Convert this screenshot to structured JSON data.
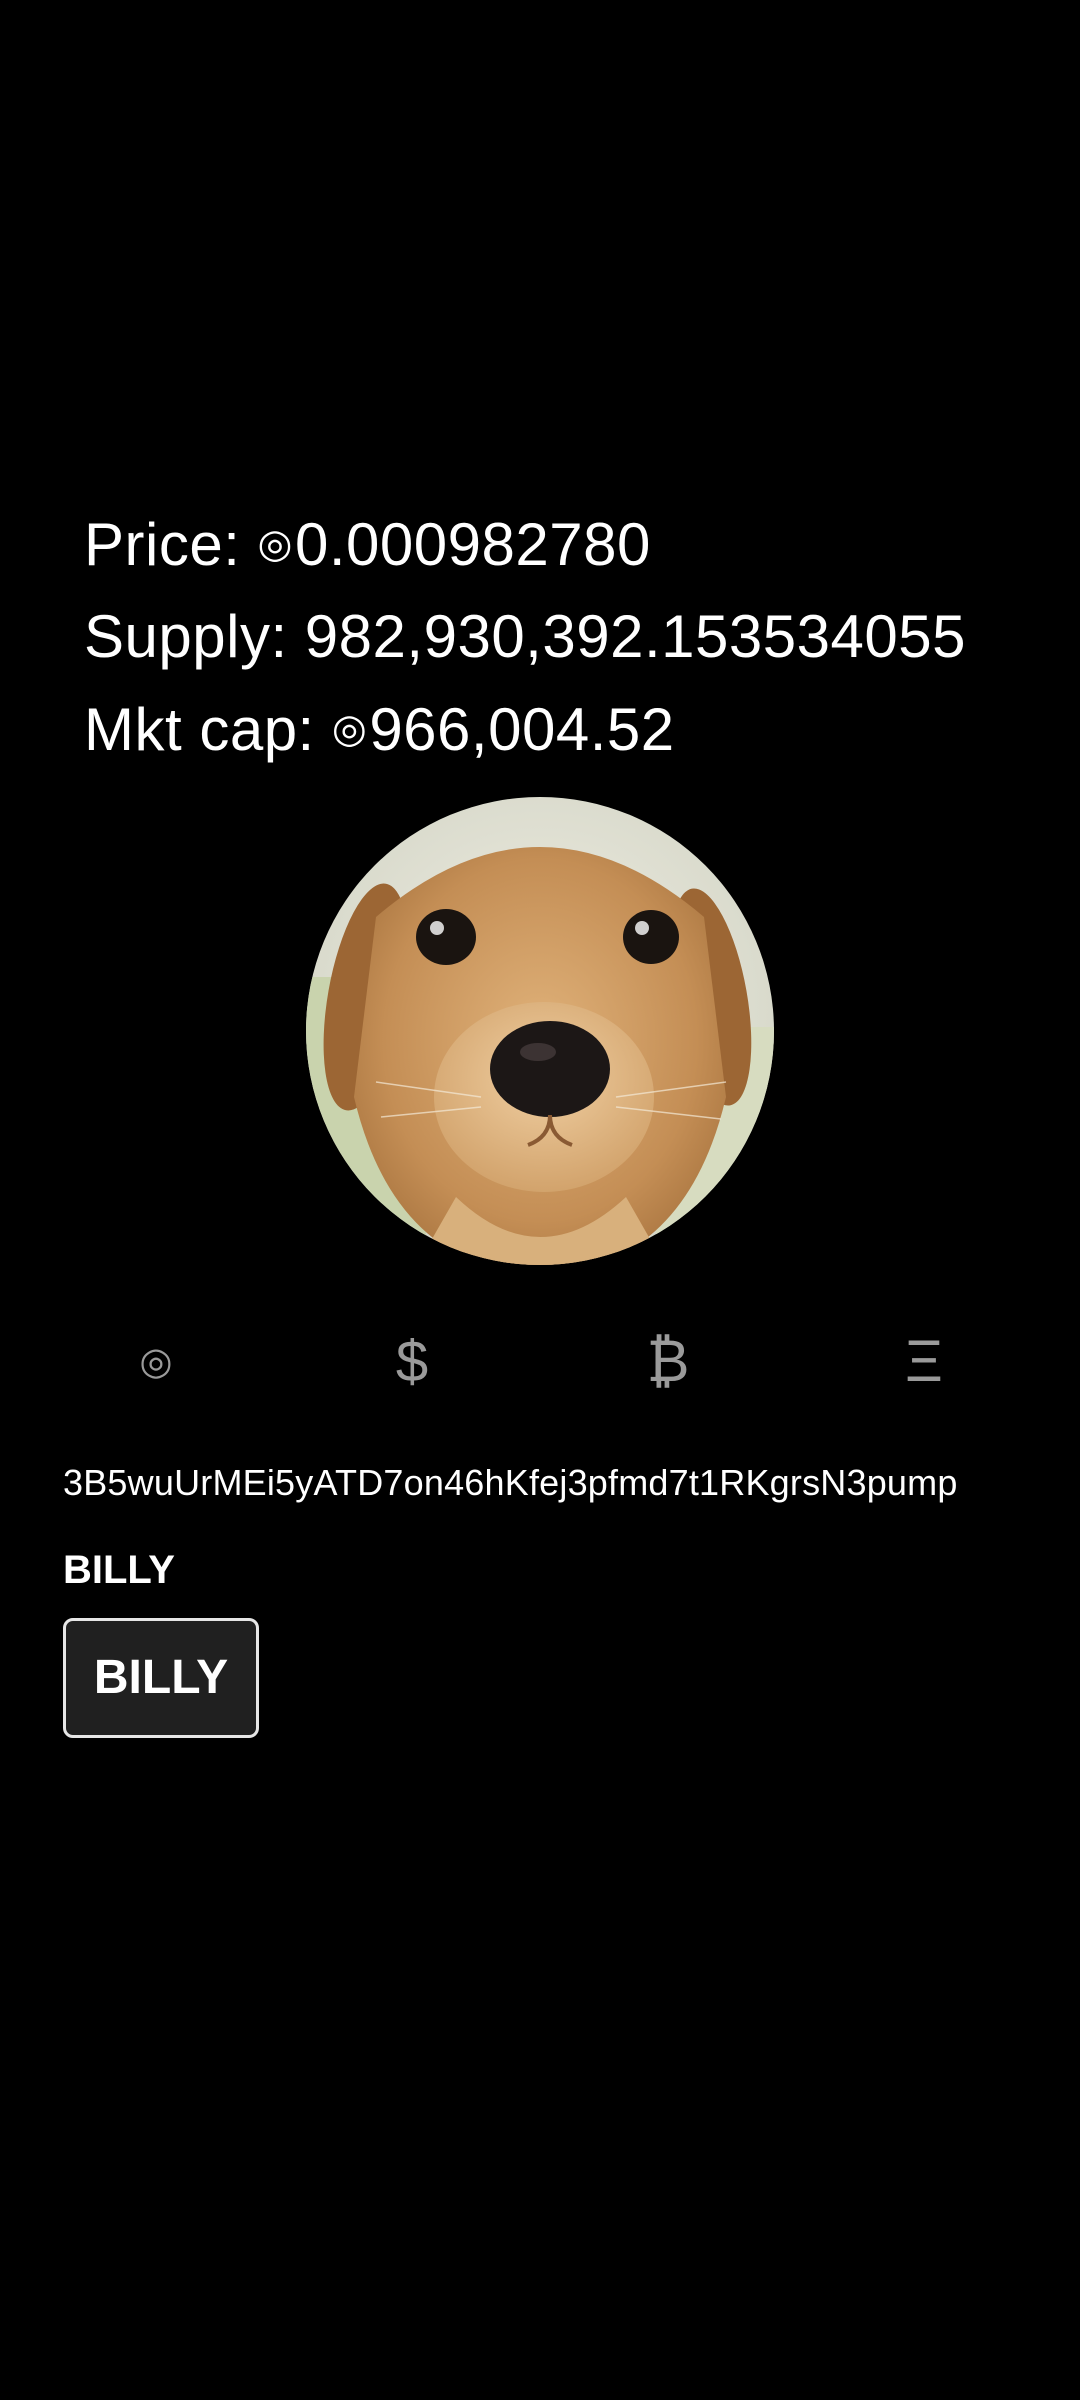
{
  "stats": {
    "price_label": "Price: ",
    "price_unit": "◎",
    "price_value": "0.000982780",
    "supply_text": "Supply: 982,930,392.153534055",
    "mktcap_label": "Mkt cap: ",
    "mktcap_unit": "◎",
    "mktcap_value": "966,004.52"
  },
  "avatar": {
    "icon": "puppy-photo"
  },
  "currency_tabs": [
    {
      "glyph": "◎",
      "icon": "sol-icon"
    },
    {
      "glyph": "$",
      "icon": "dollar-icon"
    },
    {
      "glyph": "₿",
      "icon": "bitcoin-icon"
    },
    {
      "glyph": "Ξ",
      "icon": "ethereum-icon"
    }
  ],
  "token": {
    "address": "3B5wuUrMEi5yATD7on46hKfej3pfmd7t1RKgrsN3pump",
    "symbol": "BILLY",
    "button_label": "BILLY"
  },
  "colors": {
    "background": "#000000",
    "text": "#ffffff",
    "tab_inactive": "#9a9a9a",
    "button_bg": "#202020",
    "button_border": "#e6e6e6"
  }
}
